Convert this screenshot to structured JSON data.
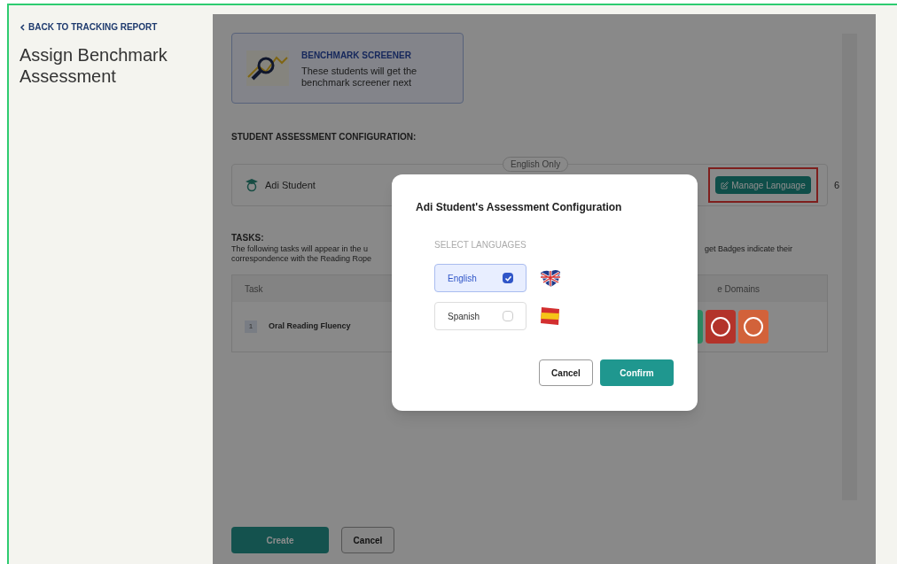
{
  "sidebar": {
    "back_link": "BACK TO TRACKING REPORT",
    "title": "Assign Benchmark Assessment"
  },
  "banner": {
    "title": "BENCHMARK SCREENER",
    "text": "These students will get the benchmark screener next"
  },
  "config": {
    "heading": "STUDENT ASSESSMENT CONFIGURATION:",
    "language_chip": "English Only",
    "student": "Adi Student",
    "manage_button": "Manage Language",
    "highlighted": true,
    "marker": "6"
  },
  "tasks": {
    "heading": "TASKS:",
    "text_left": [
      "The following tasks will appear in the u",
      "correspondence with the Reading Rope"
    ],
    "text_right": "get Badges indicate their",
    "columns": [
      "Task",
      "e Domains"
    ],
    "rows": [
      {
        "number": "1",
        "name": "Oral Reading Fluency",
        "badges": [
          {
            "color": "#2e8a62"
          },
          {
            "color": "#b3332a"
          },
          {
            "color": "#d2623a"
          }
        ]
      }
    ]
  },
  "actions": [
    "Create",
    "Cancel"
  ],
  "dialog": {
    "title": "Adi Student's Assessment Configuration",
    "section": "SELECT LANGUAGES",
    "languages": [
      {
        "name": "English",
        "checked": true,
        "kind": "uk"
      },
      {
        "name": "Spanish",
        "checked": false,
        "kind": "es"
      }
    ],
    "buttons": [
      {
        "label": "Cancel",
        "kind": "secondary"
      },
      {
        "label": "Confirm",
        "kind": "primary"
      }
    ]
  }
}
